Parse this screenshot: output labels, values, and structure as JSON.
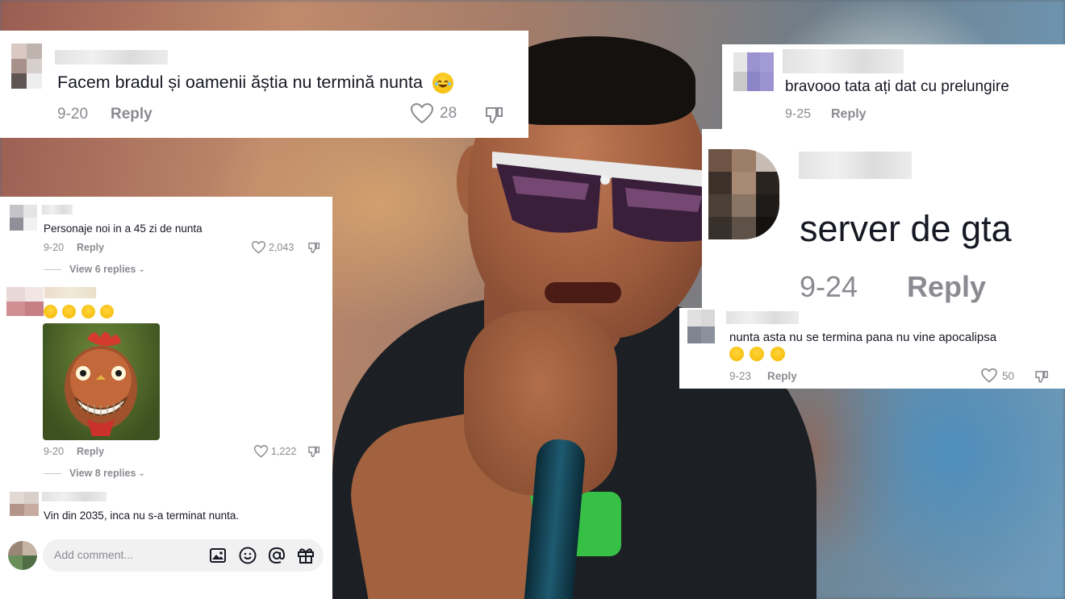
{
  "card1": {
    "text": "Facem bradul și oamenii ăștia nu termină nunta",
    "date": "9-20",
    "reply": "Reply",
    "likes": "28"
  },
  "card2": {
    "text": "bravooo tata ați dat cu prelungire",
    "date": "9-25",
    "reply": "Reply"
  },
  "card3": {
    "text": "server de gta",
    "date": "9-24",
    "reply": "Reply"
  },
  "card4": {
    "text": "nunta asta nu se termina pana nu vine apocalipsa",
    "date": "9-23",
    "reply": "Reply",
    "likes": "50"
  },
  "panel": {
    "comments": [
      {
        "text": "Personaje noi in a 45 zi de nunta",
        "date": "9-20",
        "reply": "Reply",
        "likes": "2,043",
        "view_replies": "View 6 replies"
      },
      {
        "date": "9-20",
        "reply": "Reply",
        "likes": "1,222",
        "view_replies": "View 8 replies"
      },
      {
        "text": "Vin din 2035, inca nu s-a terminat nunta."
      }
    ],
    "add_comment_placeholder": "Add comment..."
  },
  "icons": [
    "heart-icon",
    "dislike-icon",
    "image-icon",
    "emoji-icon",
    "mention-icon",
    "gift-icon",
    "chevron-down-icon"
  ],
  "colors": {
    "meta_text": "#8a8b91",
    "emoji": "#ffd43b"
  }
}
